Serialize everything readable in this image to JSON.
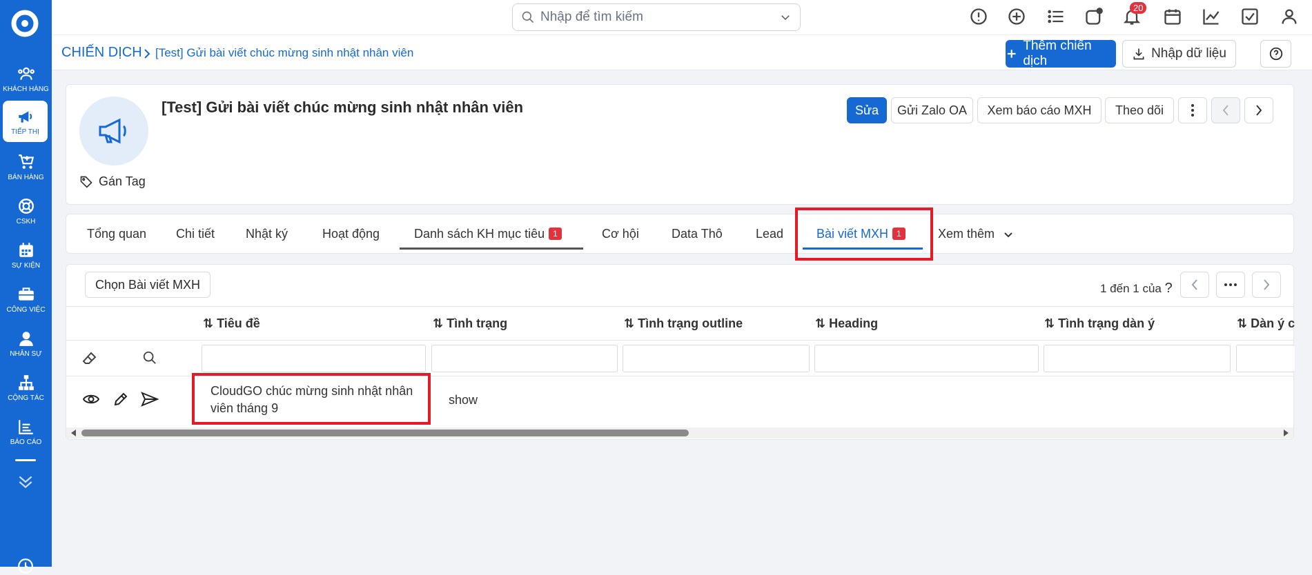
{
  "sidebar": {
    "items": [
      {
        "label": "KHÁCH HÀNG",
        "icon": "users-icon"
      },
      {
        "label": "TIẾP THỊ",
        "icon": "megaphone-icon"
      },
      {
        "label": "BÁN HÀNG",
        "icon": "cart-icon"
      },
      {
        "label": "CSKH",
        "icon": "lifebuoy-icon"
      },
      {
        "label": "SỰ KIỆN",
        "icon": "calendar-icon"
      },
      {
        "label": "CÔNG VIỆC",
        "icon": "briefcase-icon"
      },
      {
        "label": "NHÂN SỰ",
        "icon": "person-icon"
      },
      {
        "label": "CỘNG TÁC",
        "icon": "network-icon"
      },
      {
        "label": "BÁO CÁO",
        "icon": "report-icon"
      }
    ]
  },
  "topbar": {
    "search_placeholder": "Nhập để tìm kiếm",
    "notification_count": "20"
  },
  "breadcrumb": {
    "root": "CHIẾN DỊCH",
    "current": "[Test] Gửi bài viết chúc mừng sinh nhật nhân viên"
  },
  "header_actions": {
    "add_campaign": "Thêm chiến dịch",
    "import_data": "Nhập dữ liệu"
  },
  "record": {
    "title": "[Test] Gửi bài viết chúc mừng sinh nhật nhân viên",
    "tag_label": "Gán Tag",
    "actions": {
      "edit": "Sửa",
      "send_zalo": "Gửi Zalo OA",
      "view_social_report": "Xem báo cáo MXH",
      "follow": "Theo dõi"
    }
  },
  "tabs": [
    {
      "label": "Tổng quan"
    },
    {
      "label": "Chi tiết"
    },
    {
      "label": "Nhật ký"
    },
    {
      "label": "Hoạt động"
    },
    {
      "label": "Danh sách KH mục tiêu",
      "count": "1"
    },
    {
      "label": "Cơ hội"
    },
    {
      "label": "Data Thô"
    },
    {
      "label": "Lead"
    },
    {
      "label": "Bài viết MXH",
      "count": "1"
    },
    {
      "label": "Xem thêm"
    }
  ],
  "list": {
    "pick_button": "Chọn Bài viết MXH",
    "pager_text": "1 đến 1 của",
    "pager_question": "?",
    "columns": [
      "Tiêu đề",
      "Tình trạng",
      "Tình trạng outline",
      "Heading",
      "Tình trạng dàn ý",
      "Dàn ý c"
    ],
    "rows": [
      {
        "title": "CloudGO chúc mừng sinh nhật nhân viên tháng 9",
        "status": "show"
      }
    ]
  },
  "colors": {
    "brand": "#1668d2",
    "highlight": "#e21b25",
    "badge": "#e0333e"
  }
}
